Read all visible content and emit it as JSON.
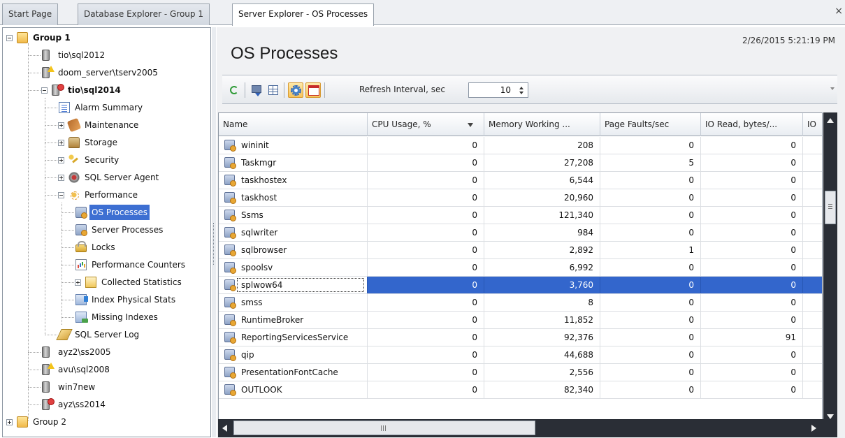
{
  "tabs": [
    {
      "label": "Start Page",
      "active": false
    },
    {
      "label": "Database Explorer - Group 1",
      "active": false
    },
    {
      "label": "Server Explorer - OS Processes",
      "active": true
    }
  ],
  "tab_close_glyph": "×",
  "tree": {
    "items": [
      {
        "label": "Group 1",
        "icon": "folder-icon",
        "bold": true
      },
      {
        "label": "tio\\sql2012",
        "icon": "server-icon"
      },
      {
        "label": "doom_server\\tserv2005",
        "icon": "server-warning-icon"
      },
      {
        "label": "tio\\sql2014",
        "icon": "server-error-icon",
        "bold": true
      },
      {
        "label": "Alarm Summary",
        "icon": "alarm-summary-icon"
      },
      {
        "label": "Maintenance",
        "icon": "maintenance-icon"
      },
      {
        "label": "Storage",
        "icon": "storage-icon"
      },
      {
        "label": "Security",
        "icon": "security-key-icon"
      },
      {
        "label": "SQL Server Agent",
        "icon": "agent-icon"
      },
      {
        "label": "Performance",
        "icon": "performance-icon"
      },
      {
        "label": "OS Processes",
        "icon": "os-processes-icon",
        "selected": true
      },
      {
        "label": "Server Processes",
        "icon": "server-processes-icon"
      },
      {
        "label": "Locks",
        "icon": "lock-icon"
      },
      {
        "label": "Performance Counters",
        "icon": "performance-counters-icon"
      },
      {
        "label": "Collected Statistics",
        "icon": "collected-statistics-icon"
      },
      {
        "label": "Index Physical Stats",
        "icon": "index-stats-icon"
      },
      {
        "label": "Missing Indexes",
        "icon": "missing-indexes-icon"
      },
      {
        "label": "SQL Server Log",
        "icon": "server-log-icon"
      },
      {
        "label": "ayz2\\ss2005",
        "icon": "server-icon"
      },
      {
        "label": "avu\\sql2008",
        "icon": "server-warning-icon"
      },
      {
        "label": "win7new",
        "icon": "server-icon"
      },
      {
        "label": "ayz\\ss2014",
        "icon": "server-error-icon"
      },
      {
        "label": "Group 2",
        "icon": "folder-icon"
      }
    ]
  },
  "page": {
    "title": "OS Processes",
    "timestamp": "2/26/2015 5:21:19 PM"
  },
  "toolbar": {
    "buttons": [
      "refresh-icon",
      "export-icon",
      "grid-settings-icon",
      "auto-refresh-icon",
      "window-icon"
    ],
    "refresh_label": "Refresh Interval, sec",
    "refresh_value": "10"
  },
  "grid": {
    "columns": [
      "Name",
      "CPU Usage, %",
      "Memory Working ...",
      "Page Faults/sec",
      "IO Read, bytes/...",
      "IO"
    ],
    "sorted_column": "CPU Usage, %",
    "rows": [
      {
        "name": "wininit",
        "cpu": "0",
        "mem": "208",
        "faults": "0",
        "io": "0"
      },
      {
        "name": "Taskmgr",
        "cpu": "0",
        "mem": "27,208",
        "faults": "5",
        "io": "0"
      },
      {
        "name": "taskhostex",
        "cpu": "0",
        "mem": "6,544",
        "faults": "0",
        "io": "0"
      },
      {
        "name": "taskhost",
        "cpu": "0",
        "mem": "20,960",
        "faults": "0",
        "io": "0"
      },
      {
        "name": "Ssms",
        "cpu": "0",
        "mem": "121,340",
        "faults": "0",
        "io": "0"
      },
      {
        "name": "sqlwriter",
        "cpu": "0",
        "mem": "984",
        "faults": "0",
        "io": "0"
      },
      {
        "name": "sqlbrowser",
        "cpu": "0",
        "mem": "2,892",
        "faults": "1",
        "io": "0"
      },
      {
        "name": "spoolsv",
        "cpu": "0",
        "mem": "6,992",
        "faults": "0",
        "io": "0"
      },
      {
        "name": "splwow64",
        "cpu": "0",
        "mem": "3,760",
        "faults": "0",
        "io": "0",
        "selected": true
      },
      {
        "name": "smss",
        "cpu": "0",
        "mem": "8",
        "faults": "0",
        "io": "0"
      },
      {
        "name": "RuntimeBroker",
        "cpu": "0",
        "mem": "11,852",
        "faults": "0",
        "io": "0"
      },
      {
        "name": "ReportingServicesService",
        "cpu": "0",
        "mem": "92,376",
        "faults": "0",
        "io": "91"
      },
      {
        "name": "qip",
        "cpu": "0",
        "mem": "44,688",
        "faults": "0",
        "io": "0"
      },
      {
        "name": "PresentationFontCache",
        "cpu": "0",
        "mem": "2,556",
        "faults": "0",
        "io": "0"
      },
      {
        "name": "OUTLOOK",
        "cpu": "0",
        "mem": "82,340",
        "faults": "0",
        "io": "0"
      }
    ]
  },
  "colors": {
    "selection": "#3366cc",
    "tree_selection": "#3d6fd2",
    "scrollbar": "#2a2e36"
  }
}
